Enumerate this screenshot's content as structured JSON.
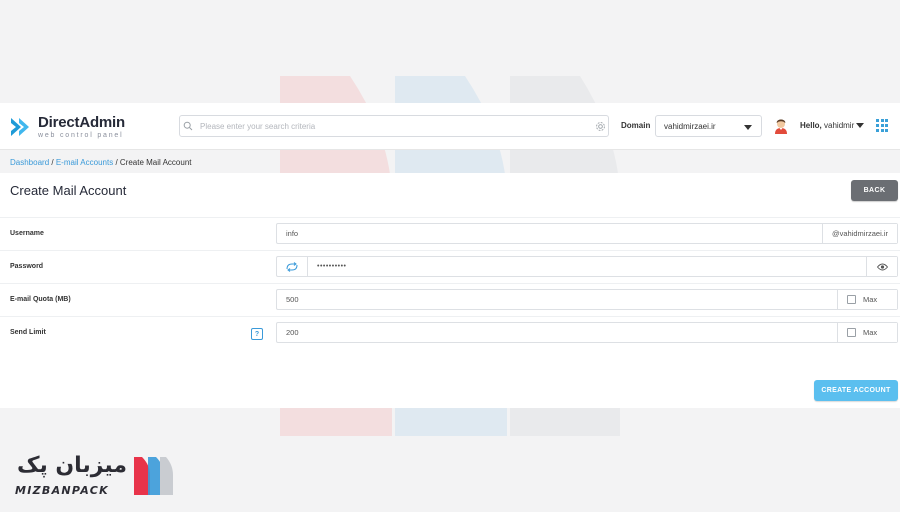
{
  "header": {
    "logo_title": "DirectAdmin",
    "logo_subtitle": "web control panel",
    "search_placeholder": "Please enter your search criteria",
    "domain_label": "Domain",
    "domain_value": "vahidmirzaei.ir",
    "hello_prefix": "Hello,",
    "username": "vahidmir"
  },
  "breadcrumb": {
    "items": [
      "Dashboard",
      "E-mail Accounts"
    ],
    "current": "Create Mail Account",
    "separator": "/"
  },
  "page": {
    "title": "Create Mail Account",
    "back_label": "BACK",
    "create_label": "CREATE ACCOUNT"
  },
  "form": {
    "username": {
      "label": "Username",
      "value": "info",
      "suffix": "@vahidmirzaei.ir"
    },
    "password": {
      "label": "Password",
      "value": "••••••••••"
    },
    "quota": {
      "label": "E-mail Quota (MB)",
      "value": "500",
      "max_label": "Max"
    },
    "send_limit": {
      "label": "Send Limit",
      "value": "200",
      "max_label": "Max",
      "help": "?"
    }
  },
  "brand": {
    "name_fa": "میزبان پک",
    "name_en": "MIZBANPACK"
  },
  "colors": {
    "accent": "#3a9ad9",
    "create_button": "#5bbfef",
    "back_button": "#6b6e73",
    "brand_red": "#e8334a",
    "brand_blue": "#3a9ad9"
  }
}
